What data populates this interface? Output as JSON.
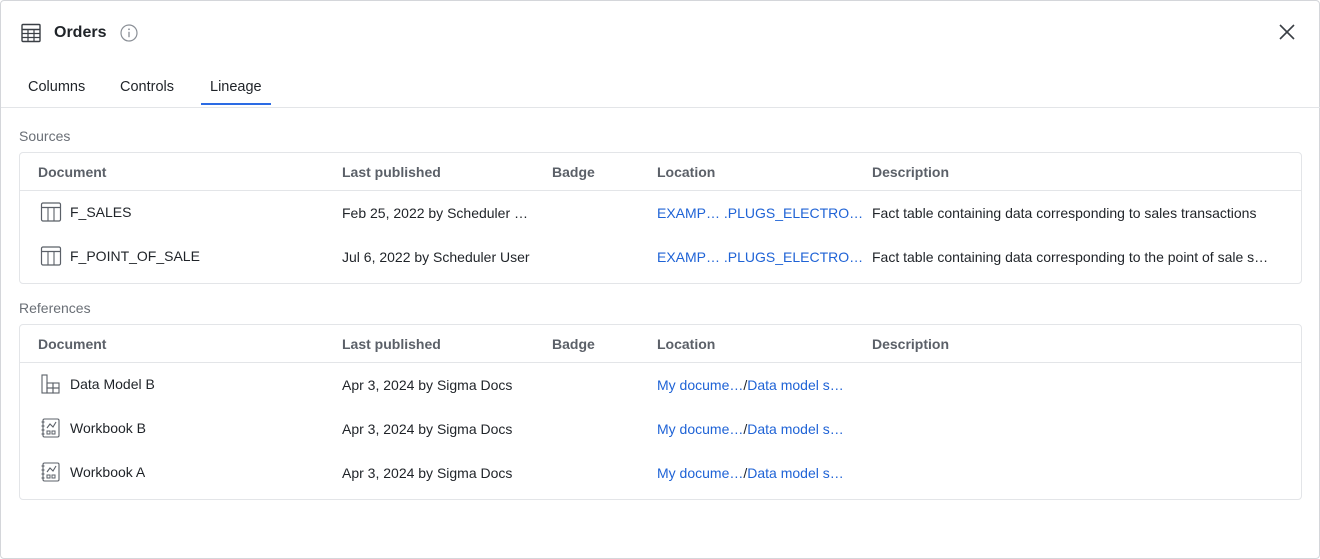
{
  "header": {
    "title": "Orders",
    "icon": "table-icon",
    "info_icon": "info-icon",
    "close_icon": "close-icon"
  },
  "tabs": [
    {
      "label": "Columns",
      "active": false
    },
    {
      "label": "Controls",
      "active": false
    },
    {
      "label": "Lineage",
      "active": true
    }
  ],
  "columns": {
    "document": "Document",
    "last_published": "Last published",
    "badge": "Badge",
    "location": "Location",
    "description": "Description"
  },
  "sources": {
    "label": "Sources",
    "rows": [
      {
        "icon": "table-icon",
        "document": "F_SALES",
        "last_published": "Feb 25, 2022 by Scheduler …",
        "badge": "",
        "location_a": "EXAMP…",
        "location_b": ".PLUGS_ELECTRO…",
        "description": "Fact table containing data corresponding to sales transactions"
      },
      {
        "icon": "table-icon",
        "document": "F_POINT_OF_SALE",
        "last_published": "Jul 6, 2022 by Scheduler User",
        "badge": "",
        "location_a": "EXAMP…",
        "location_b": ".PLUGS_ELECTRO…",
        "description": "Fact table containing data corresponding to the point of sale s…"
      }
    ]
  },
  "references": {
    "label": "References",
    "rows": [
      {
        "icon": "data-model-icon",
        "document": "Data Model B",
        "last_published": "Apr 3, 2024 by Sigma Docs",
        "badge": "",
        "location_a": "My docume…",
        "location_sep": "/",
        "location_b": "Data model s…",
        "description": ""
      },
      {
        "icon": "workbook-icon",
        "document": "Workbook B",
        "last_published": "Apr 3, 2024 by Sigma Docs",
        "badge": "",
        "location_a": "My docume…",
        "location_sep": "/",
        "location_b": "Data model s…",
        "description": ""
      },
      {
        "icon": "workbook-icon",
        "document": "Workbook A",
        "last_published": "Apr 3, 2024 by Sigma Docs",
        "badge": "",
        "location_a": "My docume…",
        "location_sep": "/",
        "location_b": "Data model s…",
        "description": ""
      }
    ]
  },
  "colors": {
    "accent": "#2b6be4",
    "link": "#1f63d6",
    "border": "#e3e5e8",
    "muted": "#6a6f76"
  }
}
